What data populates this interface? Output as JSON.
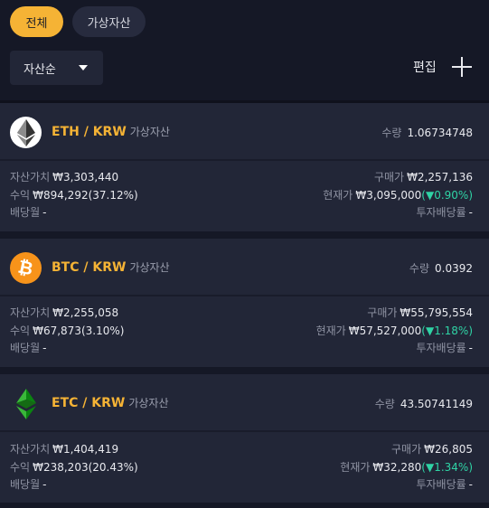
{
  "tabs": {
    "all": "전체",
    "crypto": "가상자산"
  },
  "sort": {
    "label": "자산순"
  },
  "toolbar": {
    "edit": "편집"
  },
  "labels": {
    "quantity": "수량",
    "asset_value": "자산가치",
    "profit": "수익",
    "dividend_month": "배당월",
    "buy_price": "구매가",
    "current_price": "현재가",
    "dividend_yield": "투자배당률",
    "asset_type": "가상자산"
  },
  "colors": {
    "accent": "#f5b335",
    "up": "#2fd3a5",
    "card": "#222637",
    "bg": "#151826"
  },
  "assets": [
    {
      "icon": "ethereum-icon",
      "pair": "ETH / KRW",
      "quantity": "1.06734748",
      "asset_value": "₩3,303,440",
      "profit": "₩894,292(37.12%)",
      "dividend_month": "-",
      "buy_price": "₩2,257,136",
      "current_price": "₩3,095,000",
      "change": "(▼0.90%)",
      "dividend_yield": "-"
    },
    {
      "icon": "bitcoin-icon",
      "pair": "BTC / KRW",
      "quantity": "0.0392",
      "asset_value": "₩2,255,058",
      "profit": "₩67,873(3.10%)",
      "dividend_month": "-",
      "buy_price": "₩55,795,554",
      "current_price": "₩57,527,000",
      "change": "(▼1.18%)",
      "dividend_yield": "-"
    },
    {
      "icon": "ethereum-classic-icon",
      "pair": "ETC / KRW",
      "quantity": "43.50741149",
      "asset_value": "₩1,404,419",
      "profit": "₩238,203(20.43%)",
      "dividend_month": "-",
      "buy_price": "₩26,805",
      "current_price": "₩32,280",
      "change": "(▼1.34%)",
      "dividend_yield": "-"
    }
  ]
}
